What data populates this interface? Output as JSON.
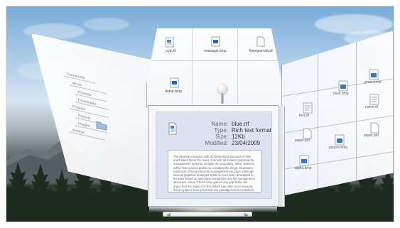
{
  "top_panel": {
    "files": [
      {
        "name": "_cyd.rtf",
        "icon": "text-file-icon"
      },
      {
        "name": "massage.bmp",
        "icon": "bmp-file-icon"
      },
      {
        "name": "firmojournal.pd",
        "icon": "generic-file-icon"
      },
      {
        "name": "donut.bmp",
        "icon": "bmp-file-icon"
      }
    ]
  },
  "details": {
    "name_label": "Name:",
    "name_value": "blue.rtf",
    "type_label": "Type:",
    "type_value": "Rich text format",
    "size_label": "Size:",
    "size_value": "12Kb",
    "modified_label": "Modified:",
    "modified_value": "23/04/2009"
  },
  "preview_text": "The desktop metaphor with its hierarchical structure of files and folders forms the basis of almost all modern graphical file management systems. Despite this popularity, these systems suffer from several problems, including the single inheritance restriction of hierarchical file management structure. Although several graphical prototype systems have been developed in the past based on alternative metaphors and file management structures, none of them have gained any popularity. We argue that the reason for this failure has often been because these systems have provided new paradigms and metaphors to replace a hierarchical system, thus ignoring many positive aspects of a hierarchical file management structure. In this paper we describe a 3D graphical file management system which complements conventional hierarchical structures with the addition of multiple inheritance of directories to address their limited hierarchical relationships.",
  "left_panel": {
    "items": [
      "Documents",
      "Music",
      "Pictures",
      "Downloads",
      "Projects",
      "Reports",
      "Images",
      "Archive"
    ]
  },
  "right_panel": {
    "files": [
      {
        "name": "paper.pdf",
        "icon": "generic-file-icon"
      },
      {
        "name": "paper.pdf",
        "icon": "generic-file-icon"
      },
      {
        "name": "green.bmp",
        "icon": "bmp-file-icon"
      },
      {
        "name": "desk.bmp",
        "icon": "bmp-file-icon"
      },
      {
        "name": "picture.bmp",
        "icon": "bmp-file-icon"
      },
      {
        "name": "alpha.bmp",
        "icon": "bmp-file-icon"
      },
      {
        "name": "notes.rtf",
        "icon": "text-file-icon"
      },
      {
        "name": "text.rtf",
        "icon": "text-file-icon"
      }
    ]
  },
  "colors": {
    "sky_top": "#77abd8",
    "sky_bottom": "#d6e5f1",
    "panel_bg": "#f7f8fa",
    "preview_bg": "#dde2f0",
    "border": "#9aa3ab",
    "text_dark": "#2d3540",
    "text_mid": "#646c74"
  }
}
